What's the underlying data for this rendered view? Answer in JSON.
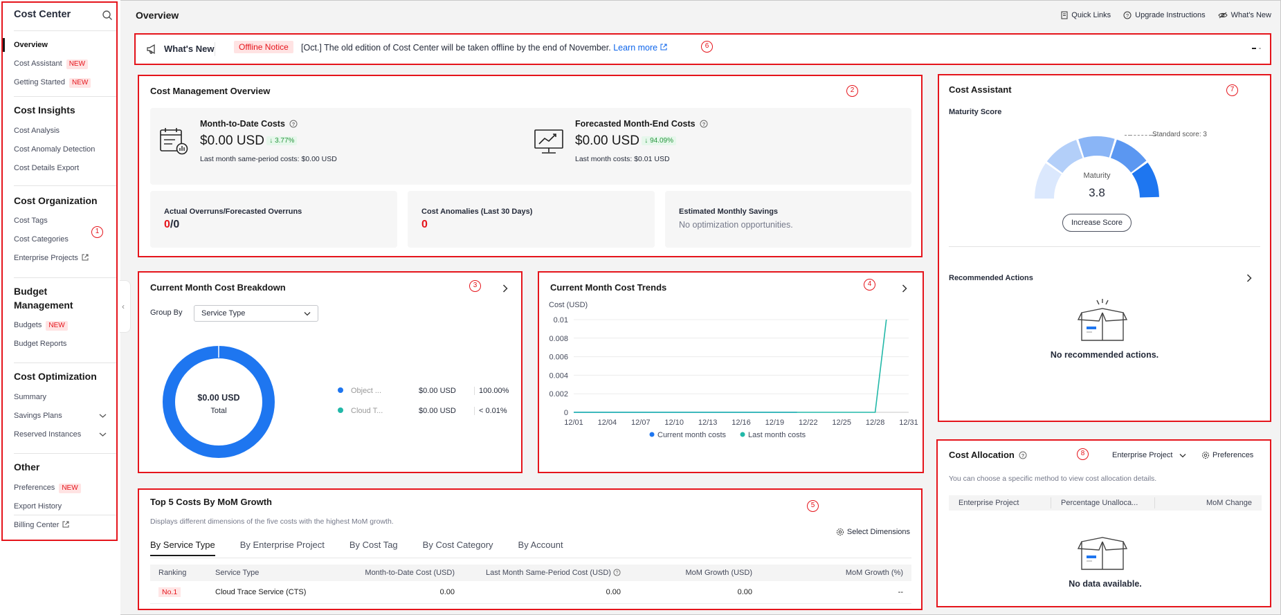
{
  "sidebar": {
    "title": "Cost Center",
    "nav_top": [
      {
        "label": "Overview"
      },
      {
        "label": "Cost Assistant",
        "badge": "NEW"
      },
      {
        "label": "Getting Started",
        "badge": "NEW"
      }
    ],
    "sections": {
      "insights": {
        "heading": "Cost Insights",
        "items": [
          "Cost Analysis",
          "Cost Anomaly Detection",
          "Cost Details Export"
        ]
      },
      "organization": {
        "heading": "Cost Organization",
        "items": [
          "Cost Tags",
          "Cost Categories",
          "Enterprise Projects"
        ]
      },
      "budget": {
        "heading": "Budget Management",
        "items": [
          "Budgets",
          "Budget Reports"
        ],
        "badge": "NEW"
      },
      "optimization": {
        "heading": "Cost Optimization",
        "items": [
          "Summary",
          "Savings Plans",
          "Reserved Instances"
        ]
      },
      "other": {
        "heading": "Other",
        "items": [
          "Preferences",
          "Export History",
          "Billing Center"
        ],
        "badge": "NEW"
      }
    }
  },
  "header": {
    "title": "Overview",
    "links": [
      "Quick Links",
      "Upgrade Instructions",
      "What's New"
    ]
  },
  "whats_new": {
    "title": "What's New",
    "badge": "Offline Notice",
    "text": "[Oct.] The old edition of Cost Center will be taken offline by the end of November.",
    "link": "Learn more"
  },
  "overview": {
    "title": "Cost Management Overview",
    "mtd": {
      "label": "Month-to-Date Costs",
      "value": "$0.00 USD",
      "change": "3.77%",
      "sub": "Last month same-period costs: $0.00 USD"
    },
    "forecast": {
      "label": "Forecasted Month-End Costs",
      "value": "$0.00 USD",
      "change": "94.09%",
      "sub": "Last month costs: $0.01 USD"
    },
    "overruns": {
      "label": "Actual Overruns/Forecasted Overruns",
      "actual": "0",
      "sep": "/",
      "forecast": "0"
    },
    "anomalies": {
      "label": "Cost Anomalies (Last 30 Days)",
      "value": "0"
    },
    "savings": {
      "label": "Estimated Monthly Savings",
      "value": "No optimization opportunities."
    }
  },
  "breakdown": {
    "title": "Current Month Cost Breakdown",
    "group_by_label": "Group By",
    "group_by_value": "Service Type",
    "donut_value": "$0.00 USD",
    "donut_label": "Total",
    "legend": [
      {
        "name": "Object ...",
        "amount": "$0.00 USD",
        "pct": "100.00%",
        "color": "#1e76f0"
      },
      {
        "name": "Cloud T...",
        "amount": "$0.00 USD",
        "pct": "< 0.01%",
        "color": "#22b8a8"
      }
    ]
  },
  "trends": {
    "title": "Current Month Cost Trends",
    "ylabel": "Cost (USD)",
    "legend_current": "Current month costs",
    "legend_last": "Last month costs"
  },
  "chart_data": {
    "type": "line",
    "title": "Current Month Cost Trends",
    "ylabel": "Cost (USD)",
    "xlabel": "",
    "x": [
      "12/01",
      "12/04",
      "12/07",
      "12/10",
      "12/13",
      "12/16",
      "12/19",
      "12/22",
      "12/25",
      "12/28",
      "12/31"
    ],
    "y_ticks": [
      "0",
      "0.002",
      "0.004",
      "0.006",
      "0.008",
      "0.01"
    ],
    "ylim": [
      0,
      0.01
    ],
    "series": [
      {
        "name": "Current month costs",
        "color": "#1e76f0",
        "points": [
          [
            0,
            0
          ],
          [
            20,
            0
          ]
        ]
      },
      {
        "name": "Last month costs",
        "color": "#22b8a8",
        "points": [
          [
            0,
            0
          ],
          [
            27,
            0
          ],
          [
            28,
            0.01
          ]
        ]
      }
    ],
    "legend": "bottom"
  },
  "top5": {
    "title": "Top 5 Costs By MoM Growth",
    "subtitle": "Displays different dimensions of the five costs with the highest MoM growth.",
    "select_dimensions": "Select Dimensions",
    "tabs": [
      "By Service Type",
      "By Enterprise Project",
      "By Cost Tag",
      "By Cost Category",
      "By Account"
    ],
    "columns": [
      "Ranking",
      "Service Type",
      "Month-to-Date Cost (USD)",
      "Last Month Same-Period Cost (USD)",
      "MoM Growth (USD)",
      "MoM Growth (%)"
    ],
    "rows": [
      {
        "rank": "No.1",
        "service": "Cloud Trace Service (CTS)",
        "mtd": "0.00",
        "last": "0.00",
        "growth": "0.00",
        "pct": "--"
      }
    ]
  },
  "assistant": {
    "title": "Cost Assistant",
    "maturity_title": "Maturity Score",
    "standard": "Standard score: 3",
    "gauge_label": "Maturity",
    "gauge_value": "3.8",
    "gauge_max": 5,
    "button": "Increase Score",
    "recommended_title": "Recommended Actions",
    "empty_text": "No recommended actions."
  },
  "allocation": {
    "title": "Cost Allocation",
    "select": "Enterprise Project",
    "preferences": "Preferences",
    "desc": "You can choose a specific method to view cost allocation details.",
    "columns": [
      "Enterprise Project",
      "Percentage Unalloca...",
      "MoM Change"
    ],
    "empty_text": "No data available."
  },
  "markers": [
    "1",
    "2",
    "3",
    "4",
    "5",
    "6",
    "7",
    "8"
  ]
}
